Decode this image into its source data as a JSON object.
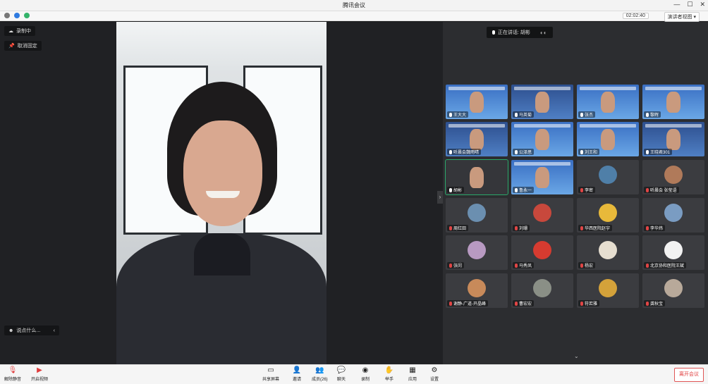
{
  "app": {
    "title": "腾讯会议"
  },
  "infobar": {
    "timer": "02:02:40",
    "view_label": "演讲者视图"
  },
  "stage": {
    "recording_label": "录制中",
    "unpin_label": "取消固定",
    "chat_placeholder": "说点什么..."
  },
  "gallery": {
    "speaking_label": "正在讲话: 胡彬",
    "participants": [
      {
        "name": "王大大",
        "mic": "on",
        "kind": "video"
      },
      {
        "name": "马英菊",
        "mic": "on",
        "kind": "video"
      },
      {
        "name": "张杰",
        "mic": "on",
        "kind": "video"
      },
      {
        "name": "黎辉",
        "mic": "on",
        "kind": "video"
      },
      {
        "name": "听晨会魏雨晴",
        "mic": "on",
        "kind": "video"
      },
      {
        "name": "公泽思",
        "mic": "on",
        "kind": "video"
      },
      {
        "name": "刘王和",
        "mic": "on",
        "kind": "video"
      },
      {
        "name": "王晓君301",
        "mic": "on",
        "kind": "video"
      },
      {
        "name": "胡彬",
        "mic": "on",
        "kind": "active"
      },
      {
        "name": "鲁永一",
        "mic": "on",
        "kind": "video"
      },
      {
        "name": "李密",
        "mic": "off",
        "kind": "avatar",
        "color": "#4f7fa8"
      },
      {
        "name": "听晨会 张莹语",
        "mic": "off",
        "kind": "avatar",
        "color": "#b07a5a"
      },
      {
        "name": "周红田",
        "mic": "off",
        "kind": "avatar",
        "color": "#6b8fb0"
      },
      {
        "name": "刘珊",
        "mic": "off",
        "kind": "avatar",
        "color": "#c8483c"
      },
      {
        "name": "华西医院赵宇",
        "mic": "off",
        "kind": "avatar",
        "color": "#e8b93a"
      },
      {
        "name": "李华炜",
        "mic": "off",
        "kind": "avatar",
        "color": "#7a9cc2"
      },
      {
        "name": "张闵",
        "mic": "off",
        "kind": "avatar",
        "color": "#b89ac2"
      },
      {
        "name": "马秀凤",
        "mic": "off",
        "kind": "avatar",
        "color": "#d63b30"
      },
      {
        "name": "杨宏",
        "mic": "off",
        "kind": "avatar",
        "color": "#e6ded0"
      },
      {
        "name": "北京协和医院王斌",
        "mic": "off",
        "kind": "avatar",
        "color": "#f2f2f2"
      },
      {
        "name": "谢静-广道-开晶峰",
        "mic": "off",
        "kind": "avatar",
        "color": "#c88a5a"
      },
      {
        "name": "曹宏宏",
        "mic": "off",
        "kind": "avatar",
        "color": "#8a8f86"
      },
      {
        "name": "符若雅",
        "mic": "off",
        "kind": "avatar",
        "color": "#d4a23a"
      },
      {
        "name": "龚秋宝",
        "mic": "off",
        "kind": "avatar",
        "color": "#b8a99a"
      }
    ]
  },
  "toolbar": {
    "unmute": "解除静音",
    "start_video": "开启视频",
    "share_screen": "共享屏幕",
    "invite": "邀请",
    "members": "成员(26)",
    "chat": "聊天",
    "record": "录制",
    "raise_hand": "举手",
    "apps": "应用",
    "settings": "设置",
    "leave": "离开会议"
  }
}
